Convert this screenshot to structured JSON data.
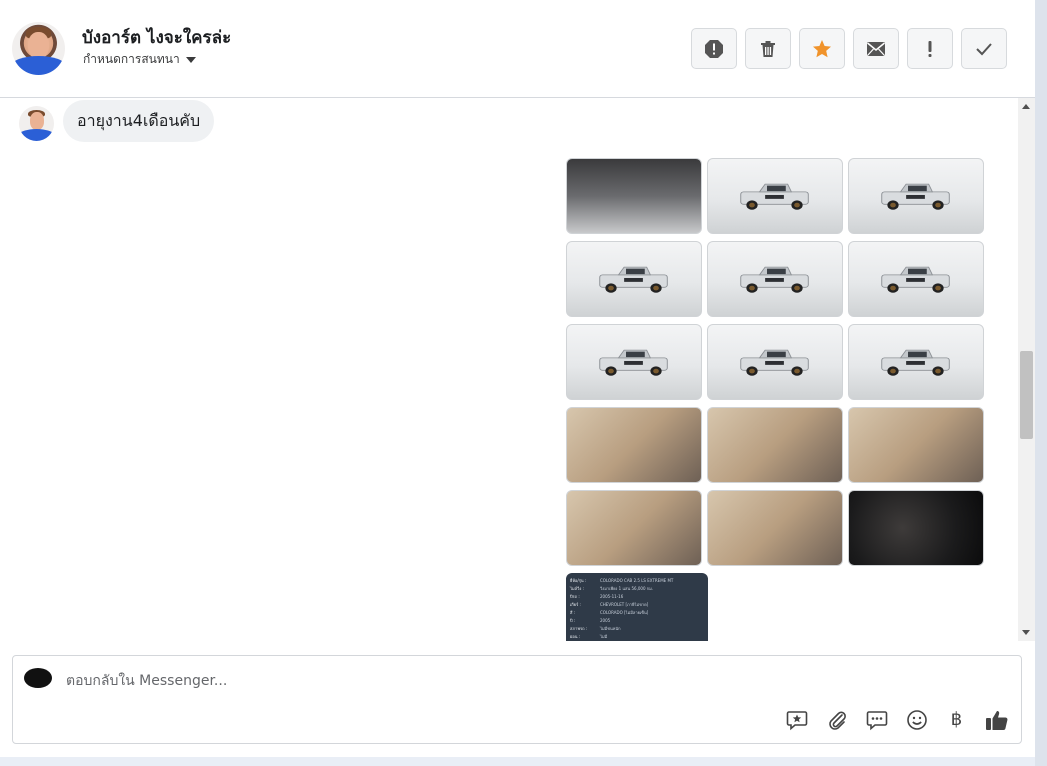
{
  "header": {
    "user_name": "บังอาร์ต ไงจะใครล่ะ",
    "manage_chat_label": "กำหนดการสนทนา",
    "actions": [
      {
        "icon": "spam-alert-icon",
        "color": "#555555"
      },
      {
        "icon": "trash-icon",
        "color": "#555555"
      },
      {
        "icon": "star-icon",
        "color": "#f0932b"
      },
      {
        "icon": "envelope-icon",
        "color": "#555555"
      },
      {
        "icon": "exclamation-icon",
        "color": "#555555"
      },
      {
        "icon": "check-icon",
        "color": "#555555"
      }
    ]
  },
  "conversation": {
    "message_text": "อายุงาน4เดือนคับ",
    "photos": [
      {
        "kind": "engine"
      },
      {
        "kind": "garage"
      },
      {
        "kind": "garage"
      },
      {
        "kind": "garage"
      },
      {
        "kind": "garage"
      },
      {
        "kind": "garage"
      },
      {
        "kind": "garage"
      },
      {
        "kind": "garage"
      },
      {
        "kind": "garage"
      },
      {
        "kind": "interior"
      },
      {
        "kind": "interior"
      },
      {
        "kind": "interior"
      },
      {
        "kind": "interior"
      },
      {
        "kind": "interior"
      },
      {
        "kind": "dash"
      }
    ],
    "spec_card_rows": [
      {
        "k": "ยี่ห้อ/รุ่น :",
        "v": "COLORADO CAB 2.5 LS EXTREME MT"
      },
      {
        "k": "ไมล์วิ่ง :",
        "v": "วิ่งมาเพียง 1 แสน 56,000 กม."
      },
      {
        "k": "ปีรถ :",
        "v": "2005-11-16"
      },
      {
        "k": "เกียร์ :",
        "v": "CHEVROLET [ภาษีไม่ขาด]"
      },
      {
        "k": "สี :",
        "v": "COLORADO [ไม่มีลายเซ็น]"
      },
      {
        "k": "ปี :",
        "v": "2005"
      },
      {
        "k": "สภาพรถ :",
        "v": "ไม่มีชนหนัก"
      },
      {
        "k": "ผ่อน :",
        "v": "ไม่มี"
      }
    ]
  },
  "composer": {
    "placeholder": "ตอบกลับใน Messenger...",
    "baht_symbol": "฿"
  },
  "colors": {
    "star": "#f0932b",
    "bubble": "#eff1f3",
    "spec_card": "#2f3a48"
  }
}
